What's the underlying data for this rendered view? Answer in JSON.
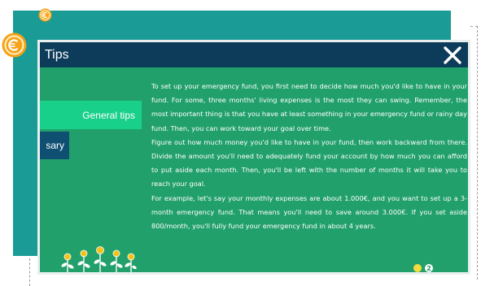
{
  "dialog": {
    "title": "Tips",
    "close_icon": "close-x-icon"
  },
  "tabs": [
    {
      "label": "General tips",
      "state": "active"
    },
    {
      "label": "sary",
      "state": "inactive"
    }
  ],
  "content": {
    "paragraphs": [
      "To set up your emergency fund, you first need to decide how much you'd like to have in your fund. For some, three months' living expenses is the most they can swing. Remember, the most important thing is that you have at least something in your emergency fund or rainy day fund. Then, you can work toward your goal over time.",
      "Figure out how much money you'd like to have in your fund, then work backward from there. Divide the amount you'll need to adequately fund your account by how much you can afford to put aside each month. Then, you'll be left with the number of months it will take you to reach your goal.",
      "For example, let's say your monthly expenses are about 1.000€, and you want to set up a 3-month emergency fund. That means you'll need to save around 3.000€. If you set aside 800/month, you'll fully fund your emergency fund in about 4 years."
    ]
  },
  "pager": {
    "page_1": "",
    "page_2": "2",
    "current": 1
  },
  "icons": {
    "coin_small": "euro-coin-icon",
    "coin_large": "euro-coin-icon",
    "plants": "money-plants-illustration"
  },
  "colors": {
    "back_panel": "#1a9b95",
    "dialog_bg": "#22a06b",
    "titlebar": "#0d3b5a",
    "tab_active": "#19d08a",
    "tab_inactive": "#0e4f72",
    "coin": "#f6a21a"
  }
}
